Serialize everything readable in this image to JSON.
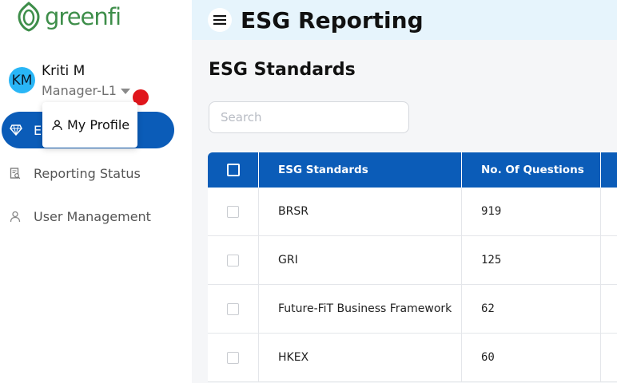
{
  "app": {
    "logo_text": "greenfi",
    "title": "ESG Reporting"
  },
  "user": {
    "initials": "KM",
    "name": "Kriti M",
    "role": "Manager-L1"
  },
  "profile_menu": {
    "item_label": "My Profile"
  },
  "sidebar": {
    "items": [
      {
        "label": "E",
        "icon": "diamond-icon",
        "active": true
      },
      {
        "label": "Reporting Status",
        "icon": "report-search-icon",
        "active": false
      },
      {
        "label": "User Management",
        "icon": "user-icon",
        "active": false
      }
    ]
  },
  "main": {
    "page_title": "ESG Standards",
    "search": {
      "placeholder": "Search",
      "value": ""
    }
  },
  "table": {
    "columns": [
      "ESG Standards",
      "No. Of Questions"
    ],
    "rows": [
      {
        "name": "BRSR",
        "questions": "919"
      },
      {
        "name": "GRI",
        "questions": "125"
      },
      {
        "name": "Future-FiT Business Framework",
        "questions": "62"
      },
      {
        "name": "HKEX",
        "questions": "60"
      }
    ]
  },
  "colors": {
    "accent": "#0b5cb8",
    "header_bg": "#e6f4fc",
    "logo_green": "#3e8e4a",
    "notification_red": "#e0161c",
    "avatar_blue": "#29b6f6"
  }
}
